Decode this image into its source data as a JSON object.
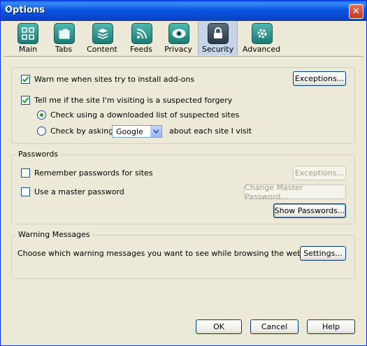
{
  "window": {
    "title": "Options",
    "close_glyph": "✕"
  },
  "toolbar": {
    "items": [
      {
        "label": "Main",
        "icon": "main-icon"
      },
      {
        "label": "Tabs",
        "icon": "tabs-icon"
      },
      {
        "label": "Content",
        "icon": "content-icon"
      },
      {
        "label": "Feeds",
        "icon": "feeds-icon"
      },
      {
        "label": "Privacy",
        "icon": "privacy-icon"
      },
      {
        "label": "Security",
        "icon": "security-icon",
        "selected": true
      },
      {
        "label": "Advanced",
        "icon": "advanced-icon"
      }
    ]
  },
  "addons": {
    "warn_label": "Warn me when sites try to install add-ons",
    "warn_checked": true,
    "exceptions_label": "Exceptions..."
  },
  "forgery": {
    "label": "Tell me if the site I'm visiting is a suspected forgery",
    "checked": true,
    "option_downloaded": "Check using a downloaded list of suspected sites",
    "option_asking": "Check by asking",
    "provider": "Google",
    "asking_suffix": "about each site I visit",
    "selected_option": "downloaded"
  },
  "passwords": {
    "legend": "Passwords",
    "remember_label": "Remember passwords for sites",
    "remember_checked": false,
    "master_label": "Use a master password",
    "master_checked": false,
    "exceptions_label": "Exceptions...",
    "change_master_label": "Change Master Password...",
    "show_passwords_label": "Show Passwords..."
  },
  "warnings": {
    "legend": "Warning Messages",
    "description": "Choose which warning messages you want to see while browsing the web",
    "settings_label": "Settings..."
  },
  "footer": {
    "ok": "OK",
    "cancel": "Cancel",
    "help": "Help"
  }
}
